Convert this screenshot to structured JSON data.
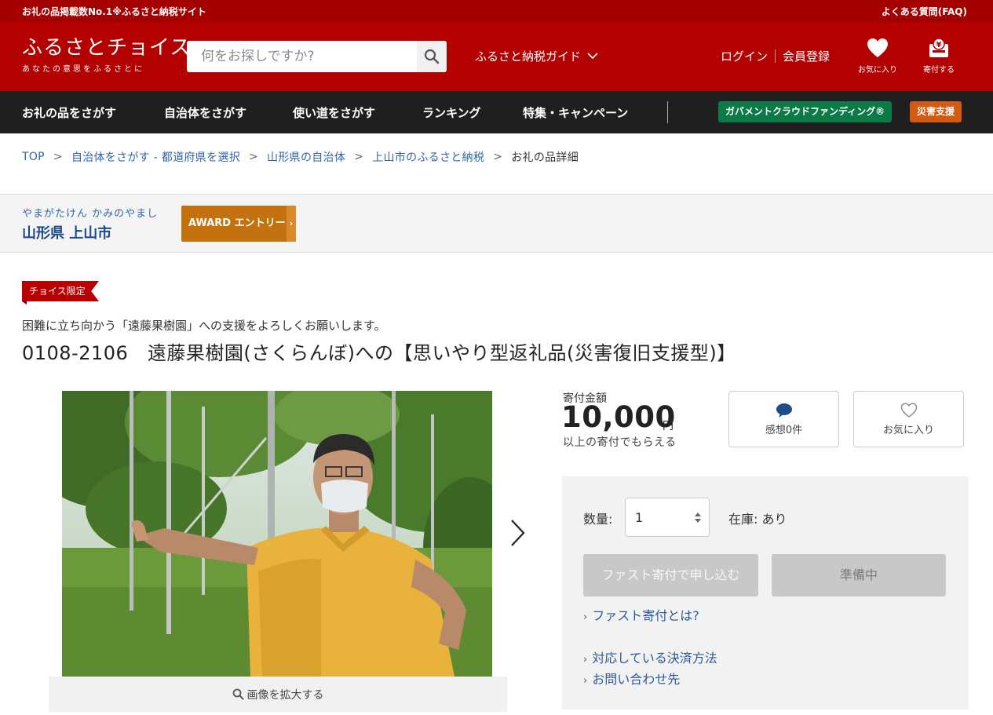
{
  "topbar": {
    "tagline": "お礼の品掲載数No.1※ふるさと納税サイト",
    "faq": "よくある質問(FAQ)"
  },
  "header": {
    "logo_main": "ふるさとチョイス",
    "logo_sub": "あなたの意思をふるさとに",
    "search_placeholder": "何をお探しですか?",
    "guide": "ふるさと納税ガイド",
    "login": "ログイン",
    "register": "会員登録",
    "favorites": "お気に入り",
    "donate": "寄付する"
  },
  "nav": {
    "items": [
      "お礼の品をさがす",
      "自治体をさがす",
      "使い道をさがす",
      "ランキング",
      "特集・キャンペーン"
    ],
    "gov_funding": "ガバメントクラウドファンディング®",
    "disaster": "災害支援"
  },
  "breadcrumb": {
    "items": [
      "TOP",
      "自治体をさがす - 都道府県を選択",
      "山形県の自治体",
      "上山市のふるさと納税"
    ],
    "current": "お礼の品詳細"
  },
  "municipality": {
    "kana": "やまがたけん かみのやまし",
    "name": "山形県 上山市",
    "award_label": "AWARD エントリー"
  },
  "product": {
    "badge": "チョイス限定",
    "subtitle": "困難に立ち向かう「遠藤果樹園」への支援をよろしくお願いします。",
    "title": "0108-2106　遠藤果樹園(さくらんぼ)への【思いやり型返礼品(災害復旧支援型)】",
    "zoom_label": "画像を拡大する"
  },
  "donation": {
    "label": "寄付金額",
    "amount": "10,000",
    "unit": "円",
    "note": "以上の寄付でもらえる",
    "thanks_button": "感想0件",
    "favorite_button": "お気に入り",
    "quantity_label": "数量:",
    "quantity_value": "1",
    "stock": "在庫: あり",
    "fast_donate": "ファスト寄付で申し込む",
    "preparing": "準備中",
    "link_fast": "ファスト寄付とは?",
    "link_payment": "対応している決済方法",
    "link_contact": "お問い合わせ先"
  },
  "colors": {
    "brand_red": "#b30000",
    "topbar_red": "#a50000",
    "nav_dark": "#1f1f1f",
    "gov_green": "#0b7a47",
    "disaster_orange": "#d45a12",
    "award_orange": "#c4720f",
    "link_blue": "#2d5a94"
  }
}
